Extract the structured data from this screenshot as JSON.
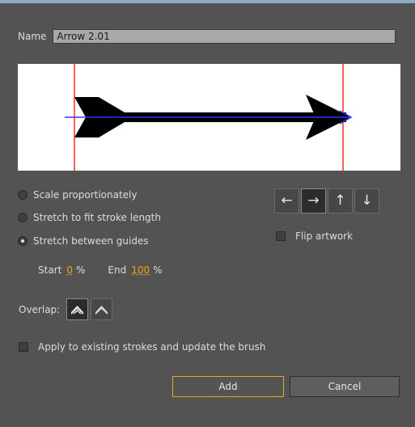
{
  "dialog": {
    "name_label": "Name",
    "name_value": "Arrow 2.01",
    "scale_options": [
      {
        "label": "Scale proportionately",
        "selected": false
      },
      {
        "label": "Stretch to fit stroke length",
        "selected": false
      },
      {
        "label": "Stretch between guides",
        "selected": true
      }
    ],
    "direction_buttons": [
      {
        "icon": "arrow-left-icon",
        "glyph": "←",
        "active": false
      },
      {
        "icon": "arrow-right-icon",
        "glyph": "→",
        "active": true
      },
      {
        "icon": "arrow-up-icon",
        "glyph": "↑",
        "active": false
      },
      {
        "icon": "arrow-down-icon",
        "glyph": "↓",
        "active": false
      }
    ],
    "flip_label": "Flip artwork",
    "start_label": "Start",
    "start_value": "0",
    "end_label": "End",
    "end_value": "100",
    "percent": "%",
    "overlap_label": "Overlap:",
    "overlap_buttons": [
      {
        "icon": "overlap-chevron-filled-icon",
        "active": true
      },
      {
        "icon": "overlap-chevron-outline-icon",
        "active": false
      }
    ],
    "apply_label": "Apply to existing strokes and update the brush",
    "add_label": "Add",
    "cancel_label": "Cancel",
    "colors": {
      "accent": "#e7a525",
      "guide": "#ff6060",
      "path": "#3030ff"
    }
  }
}
